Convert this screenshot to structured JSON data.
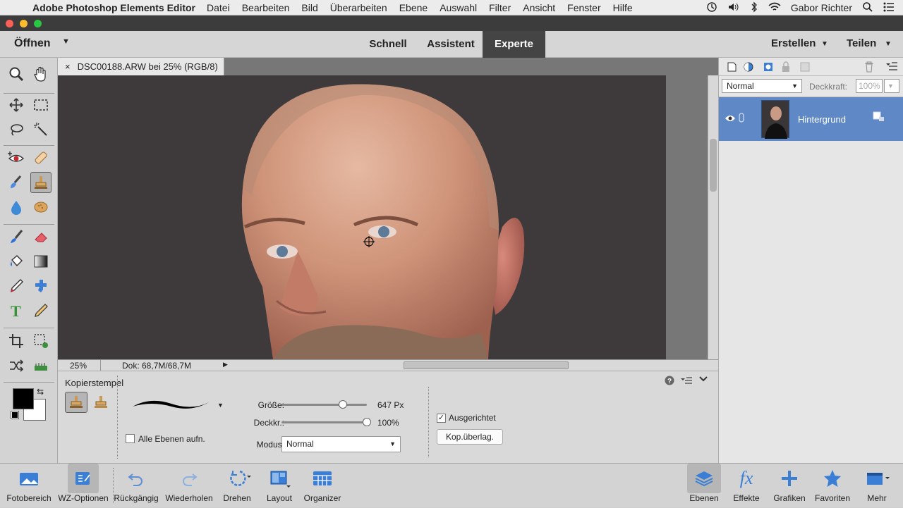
{
  "menubar": {
    "app_name": "Adobe Photoshop Elements Editor",
    "items": [
      "Datei",
      "Bearbeiten",
      "Bild",
      "Überarbeiten",
      "Ebene",
      "Auswahl",
      "Filter",
      "Ansicht",
      "Fenster",
      "Hilfe"
    ],
    "user": "Gabor Richter"
  },
  "modebar": {
    "open": "Öffnen",
    "modes": [
      "Schnell",
      "Assistent",
      "Experte"
    ],
    "active_mode": "Experte",
    "create": "Erstellen",
    "share": "Teilen"
  },
  "document": {
    "tab_title": "DSC00188.ARW bei 25% (RGB/8) *",
    "zoom": "25%",
    "doc_size": "Dok: 68,7M/68,7M"
  },
  "layers_panel": {
    "blend_mode": "Normal",
    "opacity_label": "Deckkraft:",
    "opacity_value": "100%",
    "layer_name": "Hintergrund"
  },
  "tool_options": {
    "tool_name": "Kopierstempel",
    "size_label": "Größe:",
    "size_value": "647 Px",
    "size_fraction": 0.72,
    "opacity_label": "Deckkr.:",
    "opacity_value": "100%",
    "opacity_fraction": 1.0,
    "mode_label": "Modus:",
    "mode_value": "Normal",
    "all_layers_label": "Alle Ebenen aufn.",
    "aligned_label": "Ausgerichtet",
    "aligned_checked": true,
    "overlay_button": "Kop.überlag."
  },
  "bottombar": {
    "items": [
      "Fotobereich",
      "WZ-Optionen",
      "Rückgängig",
      "Wiederholen",
      "Drehen",
      "Layout",
      "Organizer"
    ],
    "right_items": [
      "Ebenen",
      "Effekte",
      "Grafiken",
      "Favoriten",
      "Mehr"
    ]
  },
  "colors": {
    "accent_layer": "#5e88c6",
    "active_mode_bg": "#444444",
    "canvas_bg": "#3e3a3c"
  }
}
